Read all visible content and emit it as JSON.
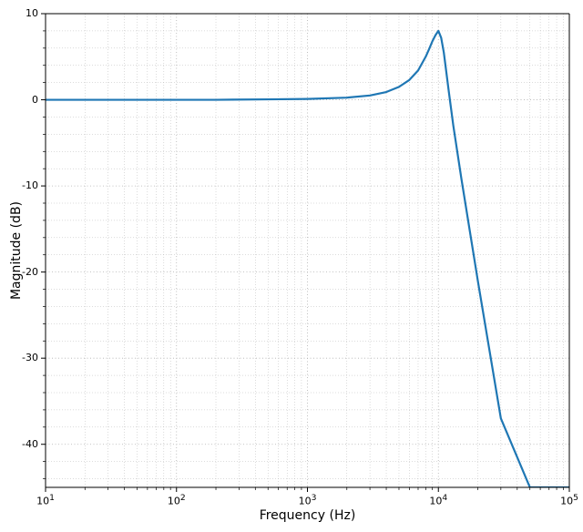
{
  "chart_data": {
    "type": "line",
    "title": "",
    "xlabel": "Frequency (Hz)",
    "ylabel": "Magnitude (dB)",
    "x_scale": "log",
    "y_scale": "linear",
    "xlim": [
      10,
      100000
    ],
    "ylim": [
      -45,
      10
    ],
    "x_ticks_major": [
      10,
      100,
      1000,
      10000,
      100000
    ],
    "x_tick_labels": [
      "10^1",
      "10^2",
      "10^3",
      "10^4",
      "10^5"
    ],
    "y_ticks_major": [
      -40,
      -30,
      -20,
      -10,
      0,
      10
    ],
    "grid": {
      "major": true,
      "minor": true
    },
    "line_color": "#1f77b4",
    "series": [
      {
        "name": "Magnitude",
        "x": [
          10,
          20,
          50,
          100,
          200,
          500,
          1000,
          2000,
          3000,
          4000,
          5000,
          6000,
          7000,
          8000,
          8500,
          9000,
          9500,
          10000,
          10500,
          11000,
          12000,
          13000,
          15000,
          20000,
          30000,
          50000,
          70000,
          100000
        ],
        "y": [
          0.0,
          0.0,
          0.0,
          0.0,
          0.0,
          0.05,
          0.1,
          0.25,
          0.5,
          0.9,
          1.5,
          2.3,
          3.4,
          5.0,
          5.9,
          6.8,
          7.5,
          8.0,
          7.2,
          5.5,
          1.0,
          -3.0,
          -9.2,
          -21.0,
          -37.0,
          -45.0,
          -45.0,
          -45.0
        ]
      }
    ]
  },
  "labels": {
    "xlabel": "Frequency (Hz)",
    "ylabel": "Magnitude (dB)",
    "xtick_exponents": [
      "1",
      "2",
      "3",
      "4",
      "5"
    ],
    "ytick_labels": [
      "-40",
      "-30",
      "-20",
      "-10",
      "0",
      "10"
    ]
  },
  "colors": {
    "line": "#1f77b4",
    "grid_major": "#b0b0b0",
    "grid_minor": "#b0b0b0",
    "spine": "#000000"
  }
}
